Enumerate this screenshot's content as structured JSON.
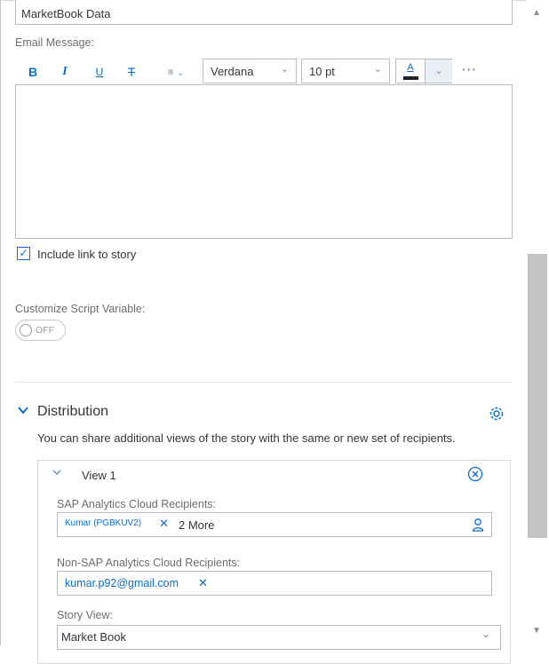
{
  "subject": {
    "value": "MarketBook Data"
  },
  "email_message": {
    "label": "Email Message:",
    "toolbar": {
      "bold": "B",
      "italic": "I",
      "underline": "U",
      "strikethrough": "T",
      "font_family": "Verdana",
      "font_size": "10 pt",
      "text_color_glyph": "A",
      "more": "···"
    },
    "body": ""
  },
  "include_link": {
    "label": "Include link to story",
    "checked": true
  },
  "script_variable": {
    "label": "Customize Script Variable:",
    "switch_text": "OFF"
  },
  "distribution": {
    "title": "Distribution",
    "description": "You can share additional views of the story with the same or new set of recipients.",
    "view": {
      "title": "View 1",
      "sac_recipients": {
        "label": "SAP Analytics Cloud Recipients:",
        "token": "Kumar (PGBKUV2)",
        "more": "2 More"
      },
      "non_sac_recipients": {
        "label": "Non-SAP Analytics Cloud Recipients:",
        "token": "kumar.p92@gmail.com"
      },
      "story_view": {
        "label": "Story View:",
        "value": "Market Book"
      }
    }
  },
  "colors": {
    "accent": "#0a6ed1",
    "text": "#32363a",
    "label": "#6a6d70",
    "border": "#b6bcc1"
  },
  "icons": [
    "bold-icon",
    "italic-icon",
    "underline-icon",
    "strikethrough-icon",
    "align-icon",
    "chevron-down-icon",
    "text-color-icon",
    "more-icon",
    "check-icon",
    "gear-icon",
    "close-circle-icon",
    "person-icon",
    "token-remove-icon"
  ]
}
